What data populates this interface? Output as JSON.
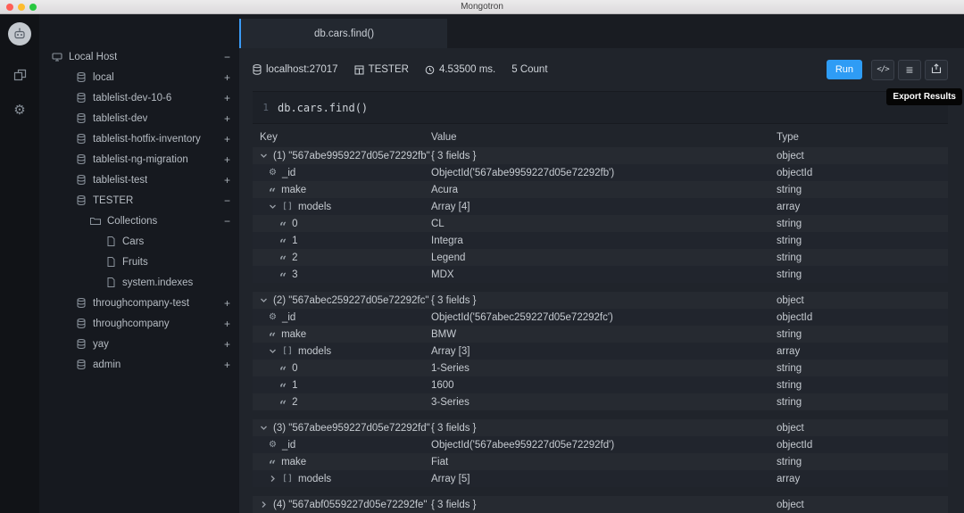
{
  "colors": {
    "accent_blue": "#2e9cf5",
    "tooltip_bg": "#050505",
    "row_even": "#262a31",
    "row_odd": "#21252d",
    "sidebar_bg": "#16191f",
    "main_bg": "#20242b"
  },
  "window": {
    "title": "Mongotron"
  },
  "tree": {
    "items": [
      {
        "label": "Local Host",
        "level": 0,
        "icon": "host",
        "toggle": "-"
      },
      {
        "label": "local",
        "level": 1,
        "icon": "db",
        "toggle": "+"
      },
      {
        "label": "tablelist-dev-10-6",
        "level": 1,
        "icon": "db",
        "toggle": "+"
      },
      {
        "label": "tablelist-dev",
        "level": 1,
        "icon": "db",
        "toggle": "+"
      },
      {
        "label": "tablelist-hotfix-inventory",
        "level": 1,
        "icon": "db",
        "toggle": "+"
      },
      {
        "label": "tablelist-ng-migration",
        "level": 1,
        "icon": "db",
        "toggle": "+"
      },
      {
        "label": "tablelist-test",
        "level": 1,
        "icon": "db",
        "toggle": "+"
      },
      {
        "label": "TESTER",
        "level": 1,
        "icon": "db",
        "toggle": "-"
      },
      {
        "label": "Collections",
        "level": 2,
        "icon": "folder",
        "toggle": "-"
      },
      {
        "label": "Cars",
        "level": 3,
        "icon": "doc",
        "toggle": ""
      },
      {
        "label": "Fruits",
        "level": 3,
        "icon": "doc",
        "toggle": ""
      },
      {
        "label": "system.indexes",
        "level": 3,
        "icon": "doc",
        "toggle": ""
      },
      {
        "label": "throughcompany-test",
        "level": 1,
        "icon": "db",
        "toggle": "+"
      },
      {
        "label": "throughcompany",
        "level": 1,
        "icon": "db",
        "toggle": "+"
      },
      {
        "label": "yay",
        "level": 1,
        "icon": "db",
        "toggle": "+"
      },
      {
        "label": "admin",
        "level": 1,
        "icon": "db",
        "toggle": "+"
      }
    ]
  },
  "tab": {
    "label": "db.cars.find()"
  },
  "toolbar": {
    "host": "localhost:27017",
    "database": "TESTER",
    "time": "4.53500 ms.",
    "count": "5 Count",
    "run_label": "Run",
    "tooltip": "Export Results"
  },
  "editor": {
    "line_number": "1",
    "code": "db.cars.find()"
  },
  "table": {
    "headers": [
      "Key",
      "Value",
      "Type"
    ],
    "groups": [
      {
        "rows": [
          {
            "indent": 0,
            "icons": [
              "chevDown"
            ],
            "key": "(1) \"567abe9959227d05e72292fb\"",
            "value": "{ 3 fields }",
            "type": "object"
          },
          {
            "indent": 1,
            "icons": [
              "gear"
            ],
            "key": "_id",
            "value": "ObjectId('567abe9959227d05e72292fb')",
            "type": "objectId"
          },
          {
            "indent": 1,
            "icons": [
              "quote"
            ],
            "key": "make",
            "value": "Acura",
            "type": "string"
          },
          {
            "indent": 1,
            "icons": [
              "chevDown",
              "brackets"
            ],
            "key": "models",
            "value": "Array [4]",
            "type": "array"
          },
          {
            "indent": 2,
            "icons": [
              "quote"
            ],
            "key": "0",
            "value": "CL",
            "type": "string"
          },
          {
            "indent": 2,
            "icons": [
              "quote"
            ],
            "key": "1",
            "value": "Integra",
            "type": "string"
          },
          {
            "indent": 2,
            "icons": [
              "quote"
            ],
            "key": "2",
            "value": "Legend",
            "type": "string"
          },
          {
            "indent": 2,
            "icons": [
              "quote"
            ],
            "key": "3",
            "value": "MDX",
            "type": "string"
          }
        ]
      },
      {
        "rows": [
          {
            "indent": 0,
            "icons": [
              "chevDown"
            ],
            "key": "(2) \"567abec259227d05e72292fc\"",
            "value": "{ 3 fields }",
            "type": "object"
          },
          {
            "indent": 1,
            "icons": [
              "gear"
            ],
            "key": "_id",
            "value": "ObjectId('567abec259227d05e72292fc')",
            "type": "objectId"
          },
          {
            "indent": 1,
            "icons": [
              "quote"
            ],
            "key": "make",
            "value": "BMW",
            "type": "string"
          },
          {
            "indent": 1,
            "icons": [
              "chevDown",
              "brackets"
            ],
            "key": "models",
            "value": "Array [3]",
            "type": "array"
          },
          {
            "indent": 2,
            "icons": [
              "quote"
            ],
            "key": "0",
            "value": "1-Series",
            "type": "string"
          },
          {
            "indent": 2,
            "icons": [
              "quote"
            ],
            "key": "1",
            "value": "1600",
            "type": "string"
          },
          {
            "indent": 2,
            "icons": [
              "quote"
            ],
            "key": "2",
            "value": "3-Series",
            "type": "string"
          }
        ]
      },
      {
        "rows": [
          {
            "indent": 0,
            "icons": [
              "chevDown"
            ],
            "key": "(3) \"567abee959227d05e72292fd\"",
            "value": "{ 3 fields }",
            "type": "object"
          },
          {
            "indent": 1,
            "icons": [
              "gear"
            ],
            "key": "_id",
            "value": "ObjectId('567abee959227d05e72292fd')",
            "type": "objectId"
          },
          {
            "indent": 1,
            "icons": [
              "quote"
            ],
            "key": "make",
            "value": "Fiat",
            "type": "string"
          },
          {
            "indent": 1,
            "icons": [
              "chevRight",
              "brackets"
            ],
            "key": "models",
            "value": "Array [5]",
            "type": "array"
          }
        ]
      },
      {
        "rows": [
          {
            "indent": 0,
            "icons": [
              "chevRight"
            ],
            "key": "(4) \"567abf0559227d05e72292fe\"",
            "value": "{ 3 fields }",
            "type": "object"
          }
        ]
      }
    ]
  }
}
